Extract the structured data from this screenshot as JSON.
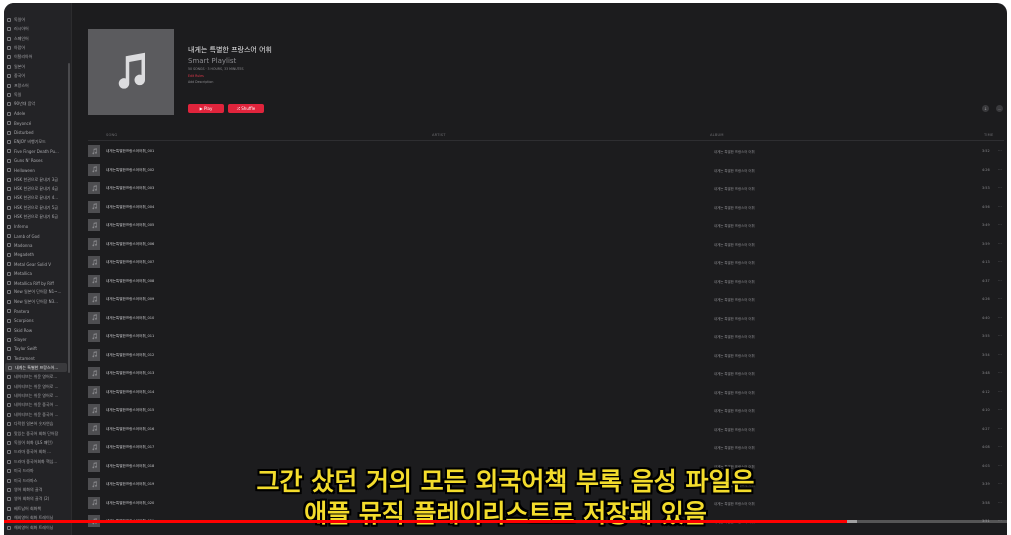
{
  "colors": {
    "accent": "#e0243c",
    "caption": "#f3dc2c",
    "progress": "#ff0000",
    "window_bg": "#1c1c1e"
  },
  "sidebar": {
    "items": [
      {
        "label": "독일어",
        "icon": "playlist-icon"
      },
      {
        "label": "러시아어",
        "icon": "playlist-icon"
      },
      {
        "label": "스페인어",
        "icon": "playlist-icon"
      },
      {
        "label": "아랍어",
        "icon": "playlist-icon"
      },
      {
        "label": "이탈리아어",
        "icon": "playlist-icon"
      },
      {
        "label": "일본어",
        "icon": "playlist-icon"
      },
      {
        "label": "중국어",
        "icon": "playlist-icon"
      },
      {
        "label": "프랑스어",
        "icon": "playlist-icon"
      },
      {
        "label": "독일",
        "icon": "playlist-icon"
      },
      {
        "label": "90년대 음악",
        "icon": "playlist-icon"
      },
      {
        "label": "Adele",
        "icon": "playlist-icon"
      },
      {
        "label": "Beyoncé",
        "icon": "playlist-icon"
      },
      {
        "label": "Disturbed",
        "icon": "playlist-icon"
      },
      {
        "label": "ENJOY 비행기모드",
        "icon": "playlist-icon"
      },
      {
        "label": "Five Finger Death Pu...",
        "icon": "playlist-icon"
      },
      {
        "label": "Guns N' Roses",
        "icon": "playlist-icon"
      },
      {
        "label": "Helloween",
        "icon": "playlist-icon"
      },
      {
        "label": "HSK 한권으로 끝내기 3급",
        "icon": "playlist-icon"
      },
      {
        "label": "HSK 한권으로 끝내기 4급",
        "icon": "playlist-icon"
      },
      {
        "label": "HSK 한권으로 끝내기 4...",
        "icon": "playlist-icon"
      },
      {
        "label": "HSK 한권으로 끝내기 5급",
        "icon": "playlist-icon"
      },
      {
        "label": "HSK 한권으로 끝내기 6급",
        "icon": "playlist-icon"
      },
      {
        "label": "Inferno",
        "icon": "playlist-icon"
      },
      {
        "label": "Lamb of God",
        "icon": "playlist-icon"
      },
      {
        "label": "Madonna",
        "icon": "playlist-icon"
      },
      {
        "label": "Megadeth",
        "icon": "playlist-icon"
      },
      {
        "label": "Metal Gear Solid V",
        "icon": "playlist-icon"
      },
      {
        "label": "Metallica",
        "icon": "playlist-icon"
      },
      {
        "label": "Metallica Riff by Riff",
        "icon": "playlist-icon"
      },
      {
        "label": "New 일본어 단어장 N1~...",
        "icon": "playlist-icon"
      },
      {
        "label": "New 일본어 단어장 N3...",
        "icon": "playlist-icon"
      },
      {
        "label": "Pantera",
        "icon": "playlist-icon"
      },
      {
        "label": "Scorpions",
        "icon": "playlist-icon"
      },
      {
        "label": "Skid Row",
        "icon": "playlist-icon"
      },
      {
        "label": "Slayer",
        "icon": "playlist-icon"
      },
      {
        "label": "Taylor Swift",
        "icon": "playlist-icon"
      },
      {
        "label": "Testament",
        "icon": "playlist-icon"
      },
      {
        "label": "내게는 특별한 프랑스어...",
        "icon": "smart-playlist-icon",
        "active": true
      },
      {
        "label": "네이티브는 쉬운 영어로...",
        "icon": "playlist-icon"
      },
      {
        "label": "네이티브는 쉬운 영어로 ...",
        "icon": "playlist-icon"
      },
      {
        "label": "네이티브는 쉬운 영어로 ...",
        "icon": "playlist-icon"
      },
      {
        "label": "네이티브는 쉬운 중국어 ...",
        "icon": "playlist-icon"
      },
      {
        "label": "네이티브는 쉬운 중국어 ...",
        "icon": "playlist-icon"
      },
      {
        "label": "다락원 일본어 숫자연습",
        "icon": "playlist-icon"
      },
      {
        "label": "맛있는 중국어 회화 단어장",
        "icon": "playlist-icon"
      },
      {
        "label": "독일어 회화 (JLS 패턴)",
        "icon": "playlist-icon"
      },
      {
        "label": "드라마 중국어 회화 ...",
        "icon": "playlist-icon"
      },
      {
        "label": "드라마 중국어회화 핵심...",
        "icon": "playlist-icon"
      },
      {
        "label": "미국 드라마",
        "icon": "playlist-icon"
      },
      {
        "label": "미국 드라마스",
        "icon": "playlist-icon"
      },
      {
        "label": "영어 회화의 골격",
        "icon": "playlist-icon"
      },
      {
        "label": "영어 회화의 골격 (2)",
        "icon": "playlist-icon"
      },
      {
        "label": "베트남어 회화책",
        "icon": "playlist-icon"
      },
      {
        "label": "해외영어 회화 트레이닝",
        "icon": "playlist-icon"
      },
      {
        "label": "해외영어 회화 트레이닝",
        "icon": "playlist-icon"
      }
    ]
  },
  "playlist": {
    "title": "내게는 특별한 프랑스어 어휘",
    "subtitle": "Smart Playlist",
    "meta": "50 SONGS · 3 HOURS, 33 MINUTES",
    "rating": "Edit Rules",
    "description": "Add Description",
    "play_label": "▶ Play",
    "shuffle_label": "⤮ Shuffle",
    "download_icon": "download-icon",
    "more_icon": "ellipsis-icon",
    "artwork_icon": "music-note-icon"
  },
  "table": {
    "columns": {
      "song": "SONG",
      "artist": "ARTIST",
      "album": "ALBUM",
      "time": "TIME"
    },
    "rows": [
      {
        "name": "내게는특별한프랑스어어휘_001",
        "album": "내게는 특별한 프랑스어 어휘",
        "time": "3:52"
      },
      {
        "name": "내게는특별한프랑스어어휘_002",
        "album": "내게는 특별한 프랑스어 어휘",
        "time": "4:26"
      },
      {
        "name": "내게는특별한프랑스어어휘_003",
        "album": "내게는 특별한 프랑스어 어휘",
        "time": "3:53"
      },
      {
        "name": "내게는특별한프랑스어어휘_004",
        "album": "내게는 특별한 프랑스어 어휘",
        "time": "4:56"
      },
      {
        "name": "내게는특별한프랑스어어휘_005",
        "album": "내게는 특별한 프랑스어 어휘",
        "time": "3:49"
      },
      {
        "name": "내게는특별한프랑스어어휘_006",
        "album": "내게는 특별한 프랑스어 어휘",
        "time": "3:59"
      },
      {
        "name": "내게는특별한프랑스어어휘_007",
        "album": "내게는 특별한 프랑스어 어휘",
        "time": "4:13"
      },
      {
        "name": "내게는특별한프랑스어어휘_008",
        "album": "내게는 특별한 프랑스어 어휘",
        "time": "4:37"
      },
      {
        "name": "내게는특별한프랑스어어휘_009",
        "album": "내게는 특별한 프랑스어 어휘",
        "time": "4:26"
      },
      {
        "name": "내게는특별한프랑스어어휘_010",
        "album": "내게는 특별한 프랑스어 어휘",
        "time": "4:40"
      },
      {
        "name": "내게는특별한프랑스어어휘_011",
        "album": "내게는 특별한 프랑스어 어휘",
        "time": "3:55"
      },
      {
        "name": "내게는특별한프랑스어어휘_012",
        "album": "내게는 특별한 프랑스어 어휘",
        "time": "3:54"
      },
      {
        "name": "내게는특별한프랑스어어휘_013",
        "album": "내게는 특별한 프랑스어 어휘",
        "time": "3:48"
      },
      {
        "name": "내게는특별한프랑스어어휘_014",
        "album": "내게는 특별한 프랑스어 어휘",
        "time": "4:12"
      },
      {
        "name": "내게는특별한프랑스어어휘_015",
        "album": "내게는 특별한 프랑스어 어휘",
        "time": "4:10"
      },
      {
        "name": "내게는특별한프랑스어어휘_016",
        "album": "내게는 특별한 프랑스어 어휘",
        "time": "4:27"
      },
      {
        "name": "내게는특별한프랑스어어휘_017",
        "album": "내게는 특별한 프랑스어 어휘",
        "time": "4:08"
      },
      {
        "name": "내게는특별한프랑스어어휘_018",
        "album": "내게는 특별한 프랑스어 어휘",
        "time": "4:03"
      },
      {
        "name": "내게는특별한프랑스어어휘_019",
        "album": "내게는 특별한 프랑스어 어휘",
        "time": "3:39"
      },
      {
        "name": "내게는특별한프랑스어어휘_020",
        "album": "내게는 특별한 프랑스어 어휘",
        "time": "3:58"
      },
      {
        "name": "내게는특별한프랑스어어휘_021",
        "album": "내게는 특별한 프랑스어 어휘",
        "time": "3:51"
      }
    ]
  },
  "video": {
    "caption_line1": "그간 샀던 거의 모든 외국어책 부록 음성 파일은",
    "caption_line2": "애플 뮤직 플레이리스트로 저장돼 있음",
    "progress_fraction": 0.84,
    "buffered_fraction": 0.85
  }
}
